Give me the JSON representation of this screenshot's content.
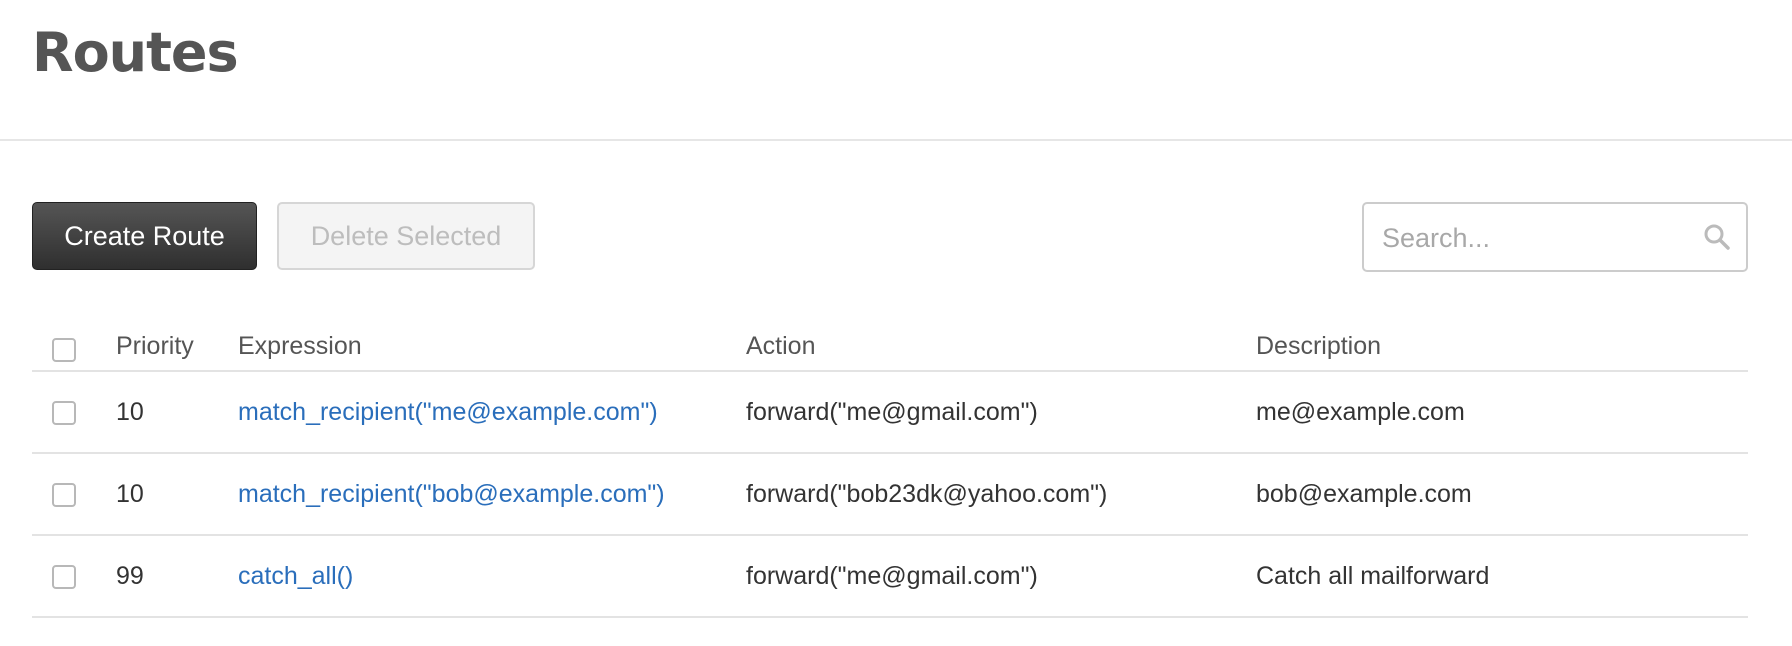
{
  "page": {
    "title": "Routes"
  },
  "toolbar": {
    "create_label": "Create Route",
    "delete_label": "Delete Selected",
    "search_placeholder": "Search...",
    "search_value": ""
  },
  "table": {
    "columns": {
      "priority": "Priority",
      "expression": "Expression",
      "action": "Action",
      "description": "Description"
    },
    "rows": [
      {
        "priority": "10",
        "expression": "match_recipient(\"me@example.com\")",
        "action": "forward(\"me@gmail.com\")",
        "description": "me@example.com"
      },
      {
        "priority": "10",
        "expression": "match_recipient(\"bob@example.com\")",
        "action": "forward(\"bob23dk@yahoo.com\")",
        "description": "bob@example.com"
      },
      {
        "priority": "99",
        "expression": "catch_all()",
        "action": "forward(\"me@gmail.com\")",
        "description": "Catch all mailforward"
      }
    ]
  },
  "colors": {
    "link": "#2a6ebb",
    "primary_button": "#3d3d3d",
    "disabled_text": "#bdbdbd"
  },
  "icons": {
    "search": "search-icon"
  }
}
